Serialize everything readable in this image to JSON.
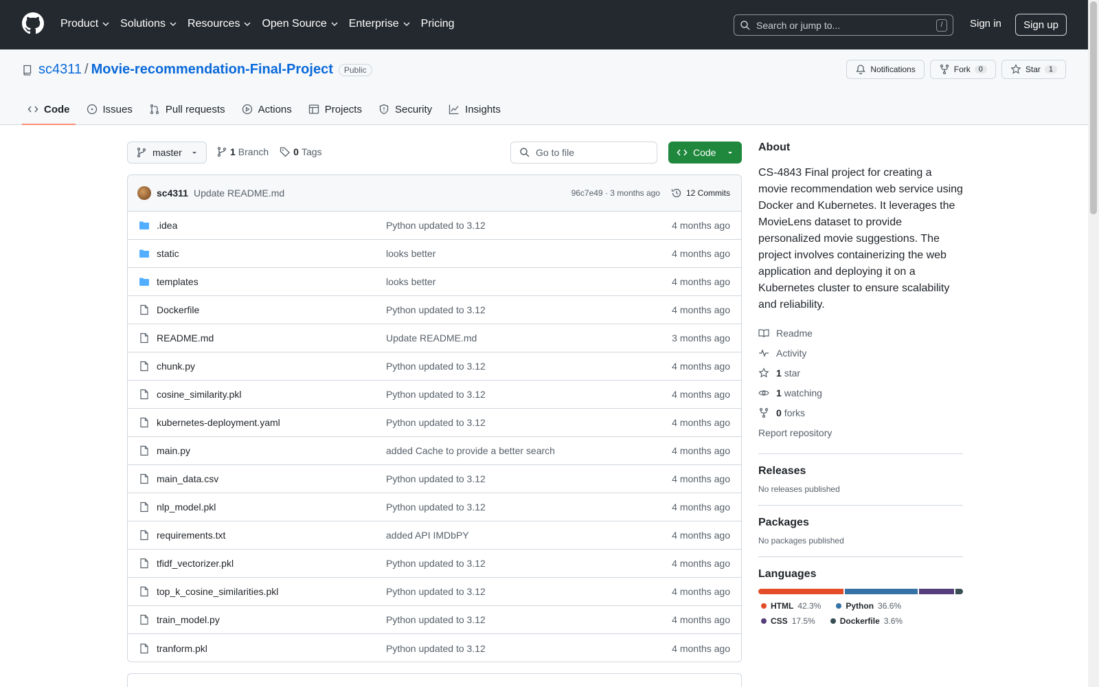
{
  "header": {
    "nav": [
      "Product",
      "Solutions",
      "Resources",
      "Open Source",
      "Enterprise",
      "Pricing"
    ],
    "search_placeholder": "Search or jump to...",
    "search_shortcut": "/",
    "signin": "Sign in",
    "signup": "Sign up"
  },
  "repo": {
    "owner": "sc4311",
    "separator": "/",
    "name": "Movie-recommendation-Final-Project",
    "visibility": "Public",
    "notifications_label": "Notifications",
    "fork_label": "Fork",
    "fork_count": "0",
    "star_label": "Star",
    "star_count": "1",
    "tabs": [
      "Code",
      "Issues",
      "Pull requests",
      "Actions",
      "Projects",
      "Security",
      "Insights"
    ]
  },
  "toolbar": {
    "branch": "master",
    "branch_count": "1",
    "branch_label": "Branch",
    "tag_count": "0",
    "tag_label": "Tags",
    "gofile_placeholder": "Go to file",
    "code_label": "Code"
  },
  "commit": {
    "author": "sc4311",
    "message": "Update README.md",
    "meta": "96c7e49 · 3 months ago",
    "commits": "12 Commits"
  },
  "files": [
    {
      "name": ".idea",
      "type": "dir",
      "msg": "Python updated to 3.12",
      "age": "4 months ago"
    },
    {
      "name": "static",
      "type": "dir",
      "msg": "looks better",
      "age": "4 months ago"
    },
    {
      "name": "templates",
      "type": "dir",
      "msg": "looks better",
      "age": "4 months ago"
    },
    {
      "name": "Dockerfile",
      "type": "file",
      "msg": "Python updated to 3.12",
      "age": "4 months ago"
    },
    {
      "name": "README.md",
      "type": "file",
      "msg": "Update README.md",
      "age": "3 months ago"
    },
    {
      "name": "chunk.py",
      "type": "file",
      "msg": "Python updated to 3.12",
      "age": "4 months ago"
    },
    {
      "name": "cosine_similarity.pkl",
      "type": "file",
      "msg": "Python updated to 3.12",
      "age": "4 months ago"
    },
    {
      "name": "kubernetes-deployment.yaml",
      "type": "file",
      "msg": "Python updated to 3.12",
      "age": "4 months ago"
    },
    {
      "name": "main.py",
      "type": "file",
      "msg": "added Cache to provide a better search",
      "age": "4 months ago"
    },
    {
      "name": "main_data.csv",
      "type": "file",
      "msg": "Python updated to 3.12",
      "age": "4 months ago"
    },
    {
      "name": "nlp_model.pkl",
      "type": "file",
      "msg": "Python updated to 3.12",
      "age": "4 months ago"
    },
    {
      "name": "requirements.txt",
      "type": "file",
      "msg": "added API IMDbPY",
      "age": "4 months ago"
    },
    {
      "name": "tfidf_vectorizer.pkl",
      "type": "file",
      "msg": "Python updated to 3.12",
      "age": "4 months ago"
    },
    {
      "name": "top_k_cosine_similarities.pkl",
      "type": "file",
      "msg": "Python updated to 3.12",
      "age": "4 months ago"
    },
    {
      "name": "train_model.py",
      "type": "file",
      "msg": "Python updated to 3.12",
      "age": "4 months ago"
    },
    {
      "name": "tranform.pkl",
      "type": "file",
      "msg": "Python updated to 3.12",
      "age": "4 months ago"
    }
  ],
  "about": {
    "heading": "About",
    "description": "CS-4843 Final project for creating a movie recommendation web service using Docker and Kubernetes. It leverages the MovieLens dataset to provide personalized movie suggestions. The project involves containerizing the web application and deploying it on a Kubernetes cluster to ensure scalability and reliability.",
    "readme": "Readme",
    "activity": "Activity",
    "stars_count": "1",
    "stars_label": "star",
    "watching_count": "1",
    "watching_label": "watching",
    "forks_count": "0",
    "forks_label": "forks",
    "report": "Report repository"
  },
  "releases": {
    "heading": "Releases",
    "note": "No releases published"
  },
  "packages": {
    "heading": "Packages",
    "note": "No packages published"
  },
  "languages": {
    "heading": "Languages",
    "items": [
      {
        "name": "HTML",
        "pct": "42.3%",
        "value": 42.3,
        "color": "#e34c26"
      },
      {
        "name": "Python",
        "pct": "36.6%",
        "value": 36.6,
        "color": "#3572A5"
      },
      {
        "name": "CSS",
        "pct": "17.5%",
        "value": 17.5,
        "color": "#563d7c"
      },
      {
        "name": "Dockerfile",
        "pct": "3.6%",
        "value": 3.6,
        "color": "#384d54"
      }
    ]
  }
}
